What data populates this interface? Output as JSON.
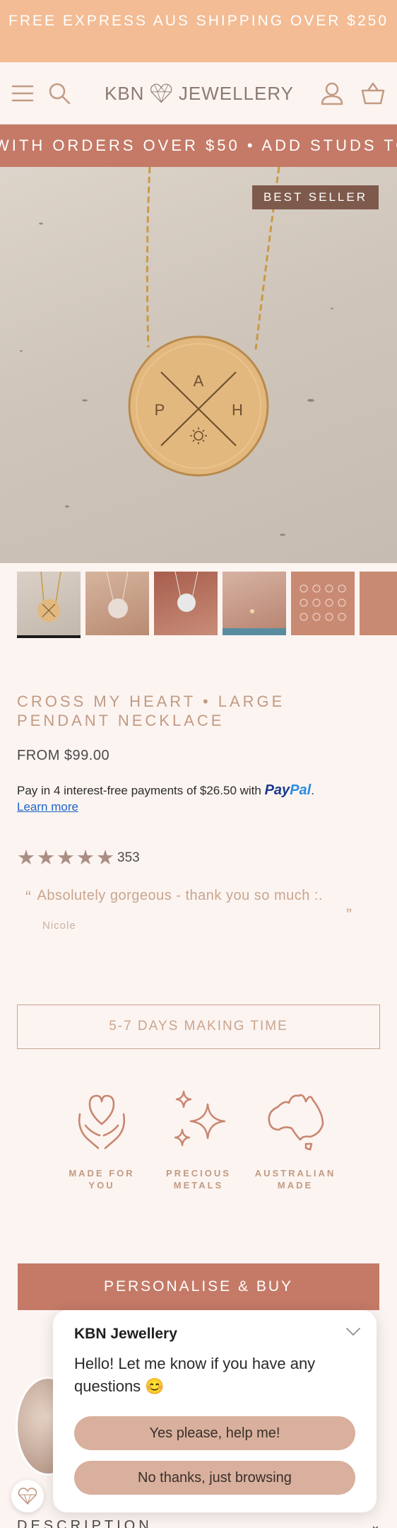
{
  "announcement": {
    "text": "FREE EXPRESS AUS SHIPPING OVER $250"
  },
  "header": {
    "logo_left": "KBN",
    "logo_right": "JEWELLERY"
  },
  "marquee": {
    "text": "WITH ORDERS OVER $50 • ADD STUDS TO"
  },
  "hero": {
    "badge": "BEST SELLER",
    "pendant_letters": [
      "A",
      "P",
      "H"
    ]
  },
  "product": {
    "title": "CROSS MY HEART • LARGE PENDANT NECKLACE",
    "price": "FROM $99.00",
    "paypal_text": "Pay in 4 interest-free payments of $26.50 with",
    "paypal_brand_a": "Pay",
    "paypal_brand_b": "Pal",
    "paypal_learn": "Learn more",
    "rating": 5,
    "review_count": "353",
    "review_quote": "Absolutely gorgeous - thank you so much :.",
    "review_author": "Nicole",
    "making_time": "5-7 DAYS MAKING TIME"
  },
  "features": [
    {
      "label": "MADE FOR YOU",
      "icon": "heart-hands-icon"
    },
    {
      "label": "PRECIOUS METALS",
      "icon": "sparkle-icon"
    },
    {
      "label": "AUSTRALIAN MADE",
      "icon": "australia-icon"
    }
  ],
  "buy_button": "PERSONALISE & BUY",
  "description_label": "DESCRIPTION",
  "chat": {
    "title": "KBN Jewellery",
    "message": "Hello! Let me know if you have any questions 😊",
    "yes_label": "Yes please, help me!",
    "no_label": "No thanks, just browsing"
  },
  "colors": {
    "announce": "#f3bc94",
    "marquee": "#c47a67",
    "accent": "#c29b83",
    "badge": "#7e5a4c",
    "chat_button": "#d9b09d"
  }
}
